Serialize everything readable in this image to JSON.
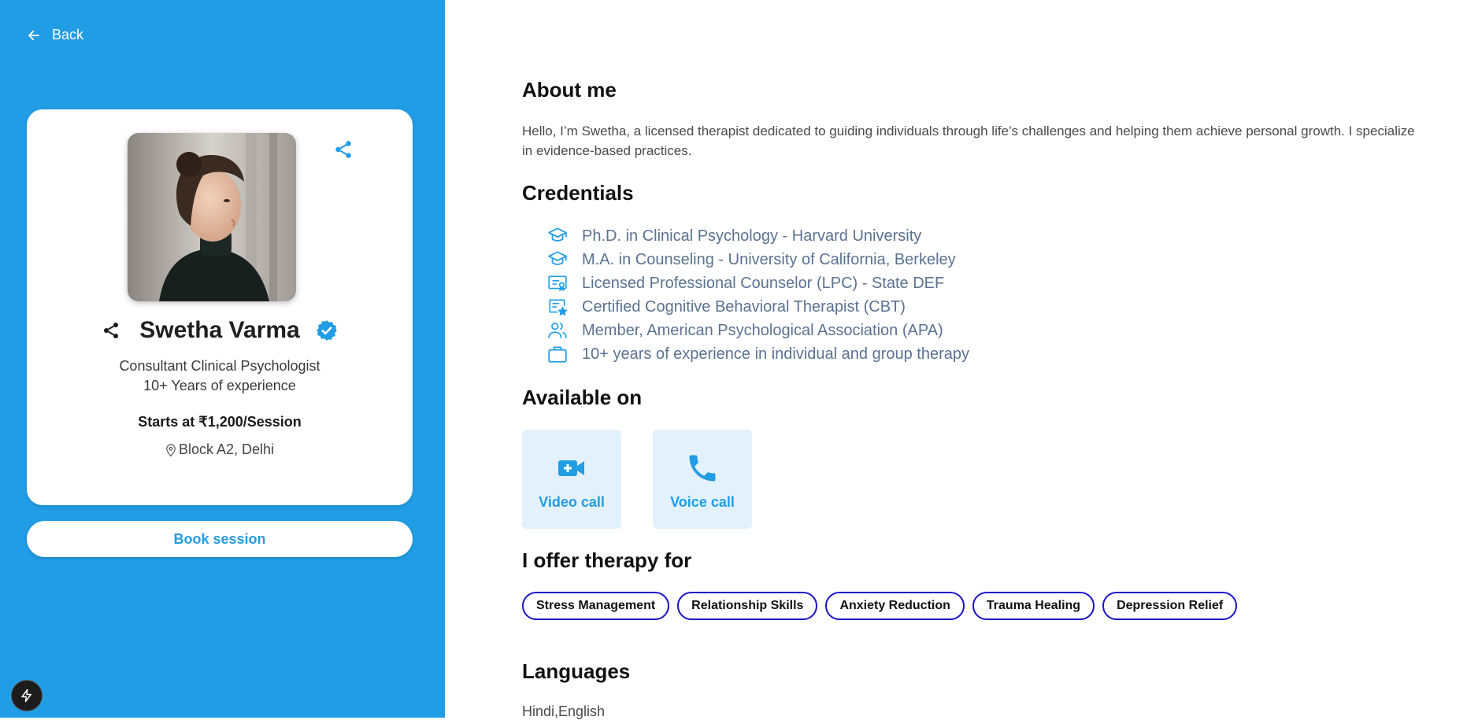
{
  "nav": {
    "back_label": "Back"
  },
  "profile": {
    "name": "Swetha Varma",
    "title": "Consultant Clinical Psychologist",
    "experience": "10+ Years of experience",
    "price": "Starts at ₹1,200/Session",
    "location": "Block A2, Delhi",
    "verified": true
  },
  "actions": {
    "book_label": "Book session"
  },
  "about": {
    "heading": "About me",
    "text": "Hello, I’m Swetha, a licensed therapist dedicated to guiding individuals through life’s challenges and helping them achieve personal growth. I specialize in evidence-based practices."
  },
  "credentials": {
    "heading": "Credentials",
    "items": [
      {
        "icon": "graduation-cap-icon",
        "label": "Ph.D. in Clinical Psychology - Harvard University"
      },
      {
        "icon": "graduation-cap-icon",
        "label": "M.A. in Counseling - University of California, Berkeley"
      },
      {
        "icon": "certificate-icon",
        "label": "Licensed Professional Counselor (LPC) - State DEF"
      },
      {
        "icon": "certificate-star-icon",
        "label": "Certified Cognitive Behavioral Therapist (CBT)"
      },
      {
        "icon": "users-icon",
        "label": "Member, American Psychological Association (APA)"
      },
      {
        "icon": "briefcase-icon",
        "label": "10+ years of experience in individual and group therapy"
      }
    ]
  },
  "availability": {
    "heading": "Available on",
    "options": [
      {
        "icon": "video-call-icon",
        "label": "Video call"
      },
      {
        "icon": "phone-icon",
        "label": "Voice call"
      }
    ]
  },
  "therapy": {
    "heading": "I offer therapy for",
    "tags": [
      "Stress Management",
      "Relationship Skills",
      "Anxiety Reduction",
      "Trauma Healing",
      "Depression Relief"
    ]
  },
  "languages": {
    "heading": "Languages",
    "text": "Hindi,English"
  },
  "colors": {
    "accent": "#219de5",
    "tag_border": "#1a13c9",
    "credential_text": "#5b7290",
    "card_bg": "#e3f1fc"
  }
}
